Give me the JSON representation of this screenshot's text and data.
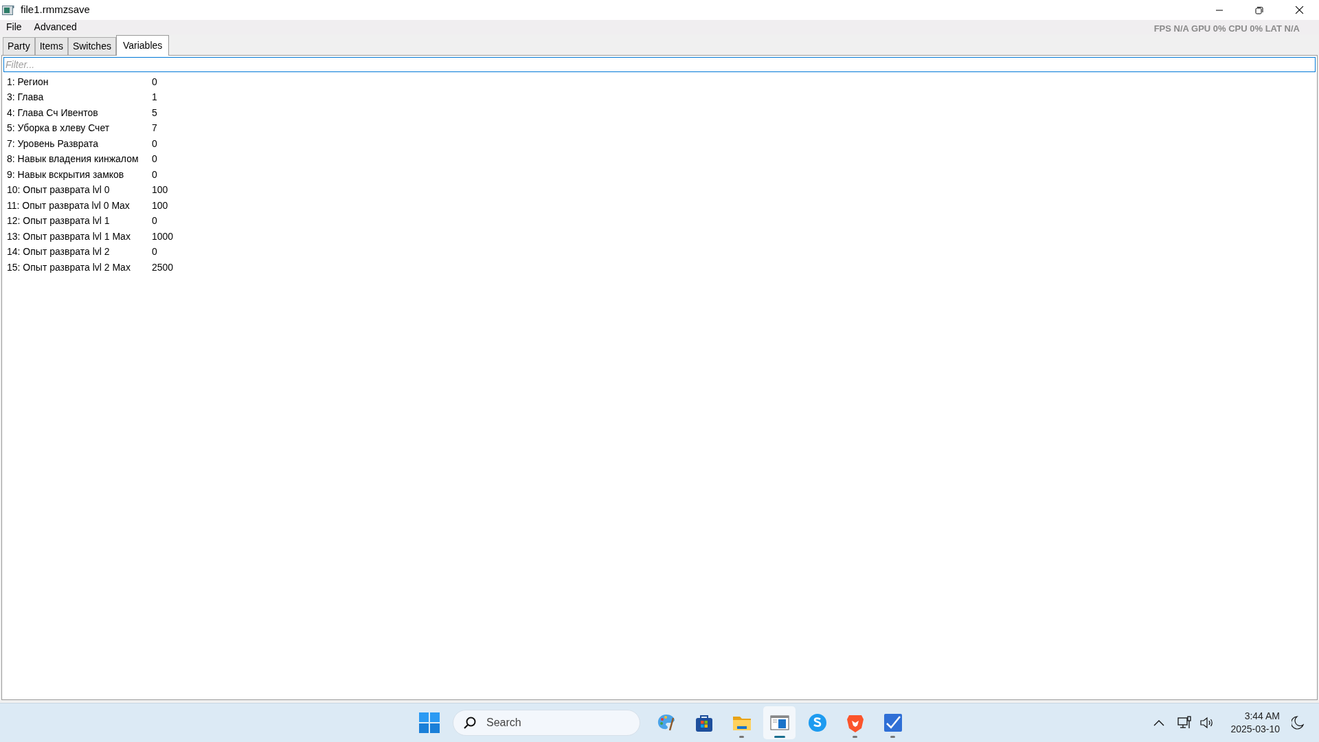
{
  "window": {
    "title": "file1.rmmzsave"
  },
  "overlay": {
    "text": "FPS N/A GPU 0% CPU 0% LAT N/A"
  },
  "menu": [
    "File",
    "Advanced"
  ],
  "tabs": [
    {
      "label": "Party",
      "selected": false
    },
    {
      "label": "Items",
      "selected": false
    },
    {
      "label": "Switches",
      "selected": false
    },
    {
      "label": "Variables",
      "selected": true
    }
  ],
  "filter": {
    "placeholder": "Filter..."
  },
  "variables": [
    {
      "name": "1: Регион",
      "value": "0"
    },
    {
      "name": "3: Глава",
      "value": "1"
    },
    {
      "name": "4: Глава Сч Ивентов",
      "value": "5"
    },
    {
      "name": "5: Уборка в хлеву Счет",
      "value": "7"
    },
    {
      "name": "7: Уровень Разврата",
      "value": "0"
    },
    {
      "name": "8: Навык владения кинжалом",
      "value": "0"
    },
    {
      "name": "9: Навык вскрытия замков",
      "value": "0"
    },
    {
      "name": "10: Опыт разврата lvl 0",
      "value": "100"
    },
    {
      "name": "11: Опыт разврата lvl 0 Max",
      "value": "100"
    },
    {
      "name": "12: Опыт разврата lvl 1",
      "value": "0"
    },
    {
      "name": "13: Опыт разврата lvl 1 Max",
      "value": "1000"
    },
    {
      "name": "14: Опыт разврата lvl 2",
      "value": "0"
    },
    {
      "name": "15: Опыт разврата lvl 2 Max",
      "value": "2500"
    }
  ],
  "taskbar": {
    "search": {
      "placeholder": "Search"
    },
    "apps": [
      {
        "kind": "paint",
        "running": false,
        "selected": false
      },
      {
        "kind": "store",
        "running": false,
        "selected": false
      },
      {
        "kind": "folder",
        "running": true,
        "selected": false
      },
      {
        "kind": "window",
        "running": true,
        "selected": true
      },
      {
        "kind": "skype",
        "running": false,
        "selected": false
      },
      {
        "kind": "lion",
        "running": true,
        "selected": false
      },
      {
        "kind": "editor",
        "running": true,
        "selected": false
      }
    ],
    "time": "3:44 AM",
    "date": "2025-03-10"
  }
}
